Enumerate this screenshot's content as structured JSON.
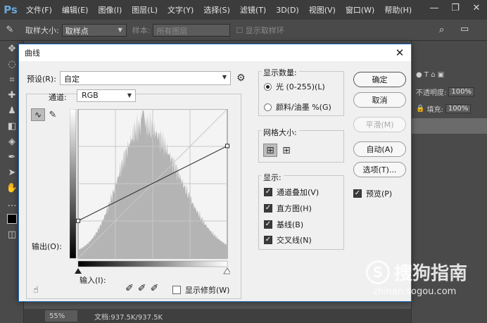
{
  "menubar": {
    "logo": "Ps",
    "items": [
      "文件(F)",
      "编辑(E)",
      "图像(I)",
      "图层(L)",
      "文字(Y)",
      "选择(S)",
      "滤镜(T)",
      "3D(D)",
      "视图(V)",
      "窗口(W)",
      "帮助(H)"
    ]
  },
  "optionsbar": {
    "sample_size_label": "取样大小:",
    "sample_size_value": "取样点",
    "sample_label": "样本:",
    "sample_value": "所有图层",
    "show_ring_label": "显示取样环"
  },
  "rightpanel": {
    "opacity_label": "不透明度:",
    "opacity_value": "100%",
    "fill_label": "填充:",
    "fill_value": "100%"
  },
  "statusbar": {
    "zoom": "55%",
    "doc": "文档:937.5K/937.5K"
  },
  "watermark": {
    "main": "搜狗指南",
    "sub": "zhinan.sogou.com"
  },
  "dialog": {
    "title": "曲线",
    "preset_label": "预设(R):",
    "preset_value": "自定",
    "channel_label": "通道:",
    "channel_value": "RGB",
    "output_label": "输出(O):",
    "input_label": "输入(I):",
    "show_clipping_label": "显示修剪(W)",
    "display_amount": {
      "title": "显示数量:",
      "light_label": "光 (0-255)(L)",
      "pigment_label": "颜料/油墨 %(G)",
      "selected": "light"
    },
    "grid_size": {
      "title": "网格大小:"
    },
    "show": {
      "title": "显示:",
      "channel_overlays": "通道叠加(V)",
      "histogram": "直方图(H)",
      "baseline": "基线(B)",
      "intersection_line": "交叉线(N)"
    },
    "buttons": {
      "ok": "确定",
      "cancel": "取消",
      "smooth": "平滑(M)",
      "auto": "自动(A)",
      "options": "选项(T)..."
    },
    "preview_label": "预览(P)"
  },
  "chart_data": {
    "type": "area",
    "xlim": [
      0,
      255
    ],
    "ylim": [
      0,
      255
    ],
    "grid": true,
    "curve_points": [
      [
        0,
        64
      ],
      [
        255,
        192
      ]
    ],
    "histogram_peak_input": 111,
    "colors": {
      "histogram": "#b4b4b4",
      "curve": "#3a3a3a",
      "grid": "#c9c9c9",
      "accent": "#1e6bbd"
    }
  }
}
